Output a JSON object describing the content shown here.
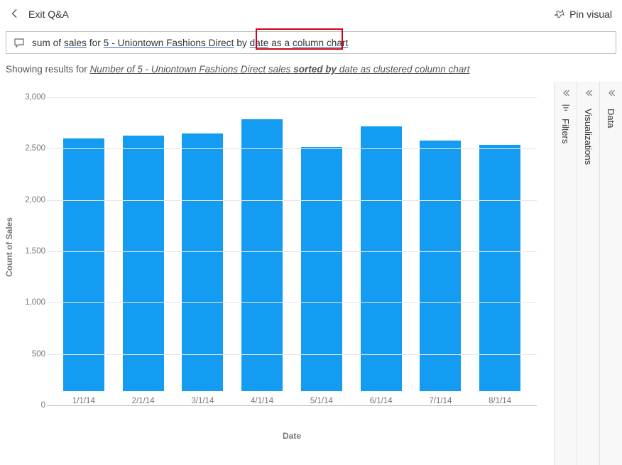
{
  "header": {
    "exit_label": "Exit Q&A",
    "pin_label": "Pin visual"
  },
  "query": {
    "t1": "sum of ",
    "u_sales": "sales",
    "t2": " for ",
    "u_store": "5 - Uniontown Fashions Direct",
    "t3": " by ",
    "u_date": "date",
    "t4": " as a ",
    "u_chart": "column chart"
  },
  "results": {
    "prefix": "Showing results for ",
    "link_part1": "Number of 5 - Uniontown Fashions Direct sales ",
    "bold_part": "sorted by",
    "link_part2": " date as clustered column chart"
  },
  "panels": {
    "filters": "Filters",
    "visualizations": "Visualizations",
    "data": "Data"
  },
  "chart_data": {
    "type": "bar",
    "title": "",
    "xlabel": "Date",
    "ylabel": "Count of Sales",
    "categories": [
      "1/1/14",
      "2/1/14",
      "3/1/14",
      "4/1/14",
      "5/1/14",
      "6/1/14",
      "7/1/14",
      "8/1/14"
    ],
    "values": [
      2460,
      2490,
      2510,
      2650,
      2380,
      2580,
      2440,
      2400
    ],
    "yticks": [
      0,
      500,
      1000,
      1500,
      2000,
      2500,
      3000
    ],
    "ylim": [
      0,
      3000
    ]
  }
}
